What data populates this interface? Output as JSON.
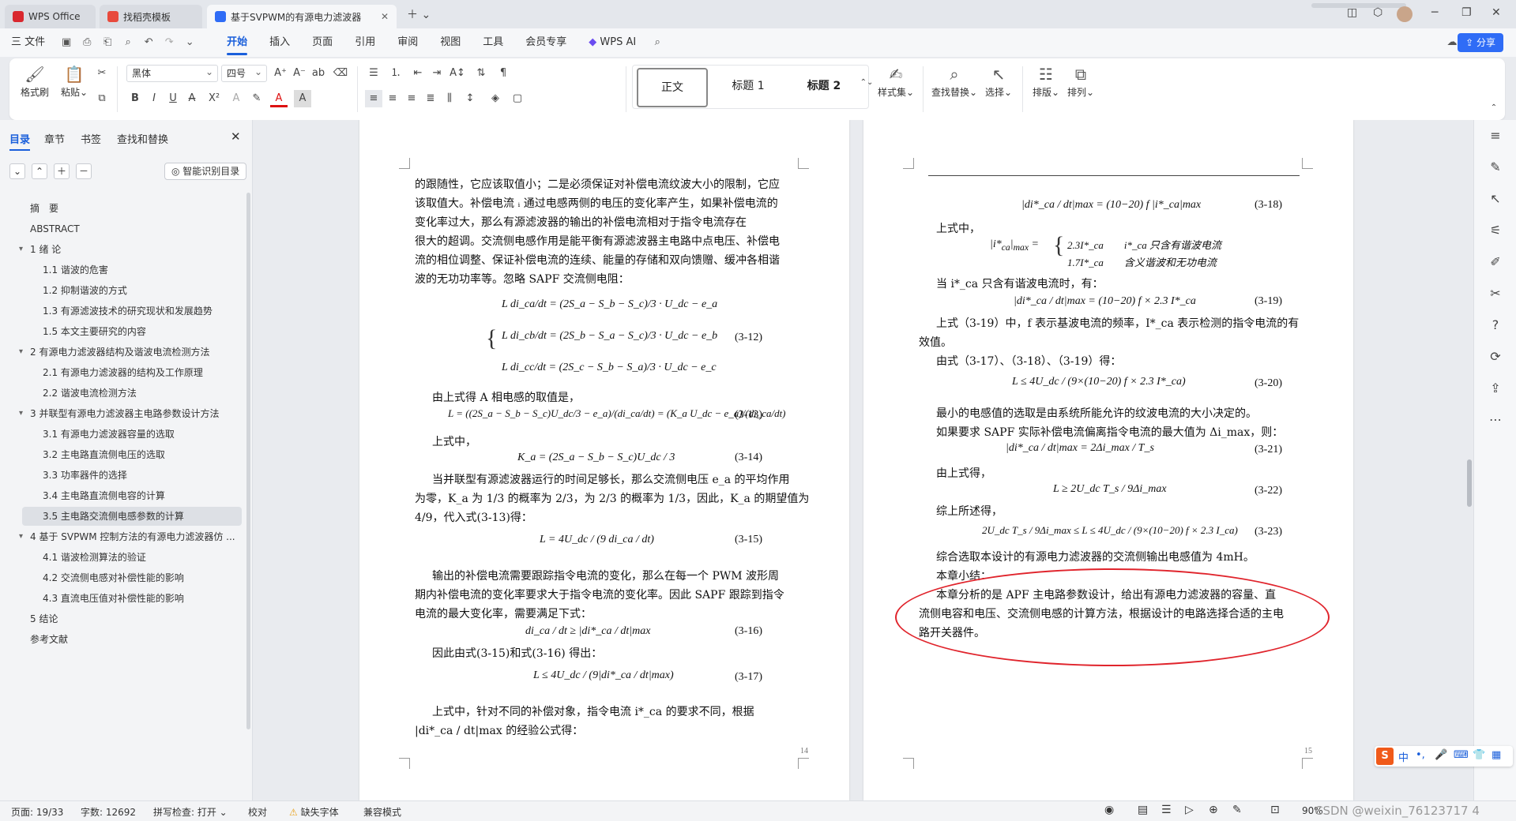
{
  "tabs": [
    {
      "label": "WPS Office",
      "color": "#d9272e"
    },
    {
      "label": "找稻壳模板",
      "color": "#e84a3c"
    },
    {
      "label": "基于SVPWM的有源电力滤波器",
      "color": "#2f6cf6"
    }
  ],
  "menu": {
    "file": "三 文件",
    "items": [
      "开始",
      "插入",
      "页面",
      "引用",
      "审阅",
      "视图",
      "工具",
      "会员专享"
    ],
    "active": "开始",
    "wps_ai": "WPS AI",
    "share": "分享"
  },
  "ribbon": {
    "format_painter": "格式刷",
    "paste": "粘贴",
    "font_name": "黑体",
    "font_size": "四号",
    "styles": [
      "正文",
      "标题 1",
      "标题 2"
    ],
    "style_set": "样式集",
    "find_replace": "查找替换",
    "select": "选择",
    "layout": "排版",
    "arrange": "排列"
  },
  "nav": {
    "tabs": [
      "目录",
      "章节",
      "书签",
      "查找和替换"
    ],
    "smart_btn": "智能识别目录",
    "toc": [
      {
        "label": "摘　要",
        "level": 0
      },
      {
        "label": "ABSTRACT",
        "level": 0
      },
      {
        "label": "1 绪 论",
        "level": 0,
        "caret": true
      },
      {
        "label": "1.1 谐波的危害",
        "level": 1
      },
      {
        "label": "1.2 抑制谐波的方式",
        "level": 1
      },
      {
        "label": "1.3 有源滤波技术的研究现状和发展趋势",
        "level": 1
      },
      {
        "label": "1.5 本文主要研究的内容",
        "level": 1
      },
      {
        "label": "2 有源电力滤波器结构及谐波电流检测方法",
        "level": 0,
        "caret": true
      },
      {
        "label": "2.1 有源电力滤波器的结构及工作原理",
        "level": 1
      },
      {
        "label": "2.2 谐波电流检测方法",
        "level": 1
      },
      {
        "label": "3 并联型有源电力滤波器主电路参数设计方法",
        "level": 0,
        "caret": true
      },
      {
        "label": "3.1 有源电力滤波器容量的选取",
        "level": 1
      },
      {
        "label": "3.2 主电路直流侧电压的选取",
        "level": 1
      },
      {
        "label": "3.3 功率器件的选择",
        "level": 1
      },
      {
        "label": "3.4 主电路直流侧电容的计算",
        "level": 1
      },
      {
        "label": "3.5 主电路交流侧电感参数的计算",
        "level": 1,
        "active": true
      },
      {
        "label": "4 基于 SVPWM 控制方法的有源电力滤波器仿 ...",
        "level": 0,
        "caret": true
      },
      {
        "label": "4.1 谐波检测算法的验证",
        "level": 1
      },
      {
        "label": "4.2 交流侧电感对补偿性能的影响",
        "level": 1
      },
      {
        "label": "4.3 直流电压值对补偿性能的影响",
        "level": 1
      },
      {
        "label": "5 结论",
        "level": 0
      },
      {
        "label": "参考文献",
        "level": 0
      }
    ]
  },
  "page_left": {
    "number": "14",
    "lines": [
      "的跟随性，它应该取值小；二是必须保证对补偿电流纹波大小的限制，它应",
      "该取值大。补偿电流 ᵢ 通过电感两侧的电压的变化率产生，如果补偿电流的",
      "变化率过大，那么有源滤波器的输出的补偿电流相对于指令电流存在",
      "很大的超调。交流侧电感作用是能平衡有源滤波器主电路中点电压、补偿电",
      "流的相位调整、保证补偿电流的连续、能量的存储和双向馈赠、缓冲各相谐",
      "波的无功功率等。忽略 SAPF 交流侧电阻："
    ],
    "eq312": [
      "L di_ca/dt = (2S_a − S_b − S_c)/3 · U_dc − e_a",
      "L di_cb/dt = (2S_b − S_a − S_c)/3 · U_dc − e_b",
      "L di_cc/dt = (2S_c − S_b − S_a)/3 · U_dc − e_c"
    ],
    "n312": "(3-12)",
    "t1": "由上式得 A 相电感的取值是，",
    "eq313": "L = ((2S_a − S_b − S_c)U_dc/3 − e_a)/(di_ca/dt) = (K_a U_dc − e_a)/(di_ca/dt)",
    "n313": "(3-13)",
    "t2": "上式中，",
    "eq314": "K_a = (2S_a − S_b − S_c)U_dc / 3",
    "n314": "(3-14)",
    "t3": "当并联型有源滤波器运行的时间足够长，那么交流侧电压 e_a 的平均作用",
    "t4": "为零，K_a 为 1/3 的概率为 2/3，为 2/3 的概率为 1/3，因此，K_a 的期望值为",
    "t5": "4/9，代入式(3-13)得：",
    "eq315": "L = 4U_dc / (9 di_ca / dt)",
    "n315": "(3-15)",
    "t6": "输出的补偿电流需要跟踪指令电流的变化，那么在每一个 PWM 波形周",
    "t7": "期内补偿电流的变化率要求大于指令电流的变化率。因此 SAPF 跟踪到指令",
    "t8": "电流的最大变化率，需要满足下式：",
    "eq316": "di_ca / dt ≥ |di*_ca / dt|max",
    "n316": "(3-16)",
    "t9": "因此由式(3-15)和式(3-16) 得出：",
    "eq317": "L ≤ 4U_dc / (9|di*_ca / dt|max)",
    "n317": "(3-17)",
    "t10": "上式中，针对不同的补偿对象，指令电流 i*_ca 的要求不同，根据",
    "t11": "|di*_ca / dt|max 的经验公式得："
  },
  "page_right": {
    "number": "15",
    "eq318": "|di*_ca / dt|max = (10−20) f |i*_ca|max",
    "n318": "(3-18)",
    "r1": "上式中，",
    "eq_case1": "2.3I*_ca　　i*_ca 只含有谐波电流",
    "eq_case2": "1.7I*_ca　　含义谐波和无功电流",
    "r2": "当 i*_ca 只含有谐波电流时，有：",
    "eq319": "|di*_ca / dt|max = (10−20) f × 2.3 I*_ca",
    "n319": "(3-19)",
    "r3": "上式（3-19）中，f 表示基波电流的频率，I*_ca 表示检测的指令电流的有",
    "r4": "效值。",
    "r5": "由式（3-17）、（3-18）、（3-19）得：",
    "eq320": "L ≤ 4U_dc / (9×(10−20) f × 2.3 I*_ca)",
    "n320": "(3-20)",
    "r6": "最小的电感值的选取是由系统所能允许的纹波电流的大小决定的。",
    "r7": "如果要求 SAPF 实际补偿电流偏离指令电流的最大值为 Δi_max，则：",
    "eq321": "|di*_ca / dt|max = 2Δi_max / T_s",
    "n321": "(3-21)",
    "r8": "由上式得，",
    "eq322": "L ≥ 2U_dc T_s / 9Δi_max",
    "n322": "(3-22)",
    "r9": "综上所述得，",
    "eq323": "2U_dc T_s / 9Δi_max ≤ L ≤ 4U_dc / (9×(10−20) f × 2.3 I_ca)",
    "n323": "(3-23)",
    "r10": "综合选取本设计的有源电力滤波器的交流侧输出电感值为 4mH。",
    "r11": "本章小结：",
    "r12": "本章分析的是 APF 主电路参数设计，给出有源电力滤波器的容量、直",
    "r13": "流侧电容和电压、交流侧电感的计算方法，根据设计的电路选择合适的主电",
    "r14": "路开关器件。"
  },
  "status": {
    "page": "页面: 19/33",
    "words": "字数: 12692",
    "spell": "拼写检查: 打开",
    "proof": "校对",
    "missing_font": "缺失字体",
    "compat": "兼容模式",
    "zoom": "90%",
    "watermark": "CSDN @weixin_76123717 4"
  },
  "ime": {
    "label": "中"
  },
  "colors": {
    "accent": "#1a5fdb",
    "annotation": "#e0242c"
  }
}
